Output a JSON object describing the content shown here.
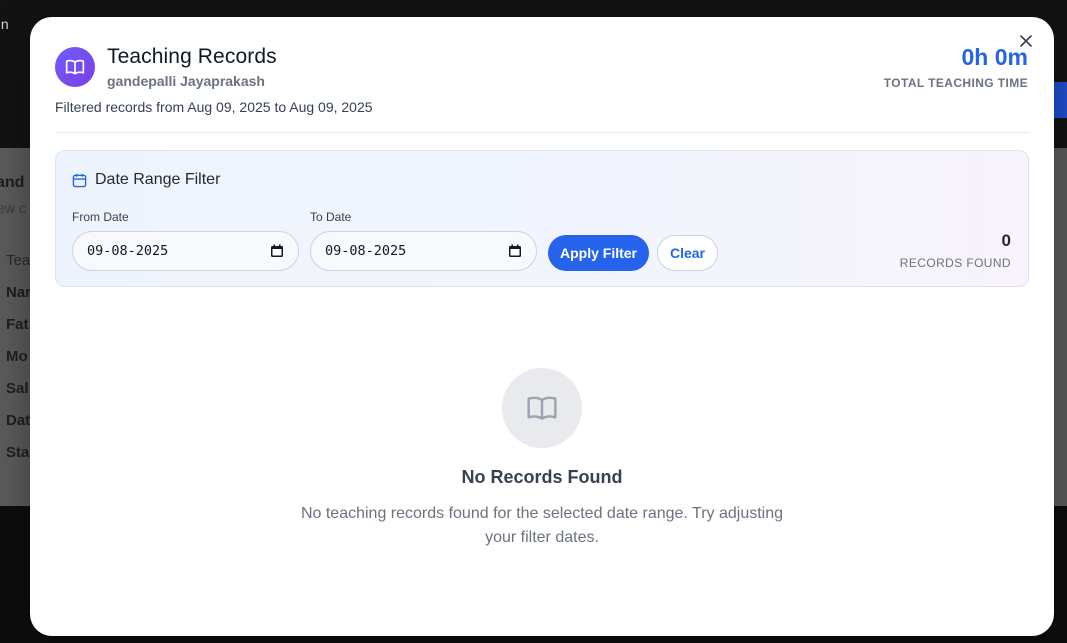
{
  "background": {
    "admin_fragment": "nin",
    "title_fragment": "and",
    "subtitle_fragment": "iew c",
    "rows": [
      "Tea",
      "Nar",
      "Fat",
      "Mo",
      "Sal",
      "Dat",
      "Sta"
    ]
  },
  "modal": {
    "title": "Teaching Records",
    "teacher_name": "gandepalli Jayaprakash",
    "filter_note": "Filtered records from Aug 09, 2025 to Aug 09, 2025",
    "total_time": "0h 0m",
    "total_time_label": "TOTAL TEACHING TIME",
    "close_icon": "close-icon",
    "header_icon": "book-open-icon"
  },
  "filter": {
    "title": "Date Range Filter",
    "title_icon": "calendar-icon",
    "from_label": "From Date",
    "from_value": "09-08-2025",
    "to_label": "To Date",
    "to_value": "09-08-2025",
    "apply_label": "Apply Filter",
    "clear_label": "Clear",
    "records_count": "0",
    "records_label": "RECORDS FOUND"
  },
  "empty_state": {
    "icon": "book-open-icon",
    "title": "No Records Found",
    "description": "No teaching records found for the selected date range. Try adjusting your filter dates."
  },
  "colors": {
    "accent": "#2563eb",
    "header_icon_gradient_start": "#6d5dfc",
    "header_icon_gradient_end": "#7b3fe4"
  }
}
